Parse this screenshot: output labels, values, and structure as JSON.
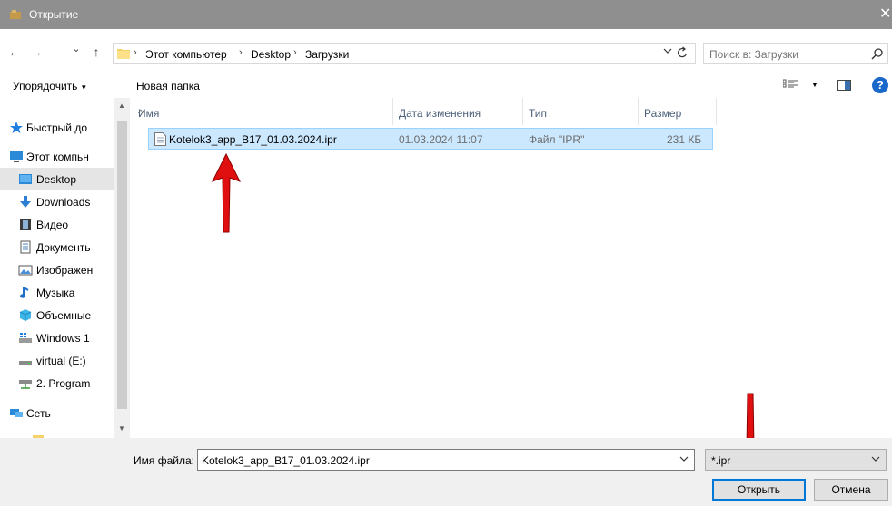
{
  "window": {
    "title": "Открытие",
    "close_glyph": "✕"
  },
  "nav": {
    "back": "←",
    "forward": "→",
    "recent": "⌄",
    "up": "↑"
  },
  "breadcrumb": [
    "Этот компьютер",
    "Desktop",
    "Загрузки"
  ],
  "search": {
    "placeholder": "Поиск в: Загрузки"
  },
  "toolbar": {
    "organize": "Упорядочить",
    "new_folder": "Новая папка"
  },
  "sidebar": {
    "items": [
      {
        "label": "Быстрый до",
        "icon": "star-icon"
      },
      {
        "label": "Этот компьн",
        "icon": "computer-icon"
      },
      {
        "label": "Desktop",
        "icon": "desktop-folder-icon",
        "selected": true
      },
      {
        "label": "Downloads",
        "icon": "download-icon"
      },
      {
        "label": "Видео",
        "icon": "video-icon"
      },
      {
        "label": "Документь",
        "icon": "documents-icon"
      },
      {
        "label": "Изображен",
        "icon": "pictures-icon"
      },
      {
        "label": "Музыка",
        "icon": "music-icon"
      },
      {
        "label": "Объемные",
        "icon": "3d-objects-icon"
      },
      {
        "label": "Windows 1",
        "icon": "drive-icon"
      },
      {
        "label": "virtual (E:)",
        "icon": "drive-icon"
      },
      {
        "label": "2. Program",
        "icon": "network-drive-icon"
      },
      {
        "label": "Сеть",
        "icon": "network-icon"
      }
    ]
  },
  "columns": {
    "name": "Имя",
    "date": "Дата изменения",
    "type": "Тип",
    "size": "Размер"
  },
  "files": [
    {
      "name": "Kotelok3_app_B17_01.03.2024.ipr",
      "date": "01.03.2024 11:07",
      "type": "Файл \"IPR\"",
      "size": "231 КБ"
    }
  ],
  "footer": {
    "filename_label": "Имя файла:",
    "filename_value": "Kotelok3_app_B17_01.03.2024.ipr",
    "filter": "*.ipr",
    "open": "Открыть",
    "cancel": "Отмена"
  },
  "colors": {
    "selection": "#cce8ff",
    "accent": "#0078d7",
    "annotation_arrow": "#e01010"
  }
}
